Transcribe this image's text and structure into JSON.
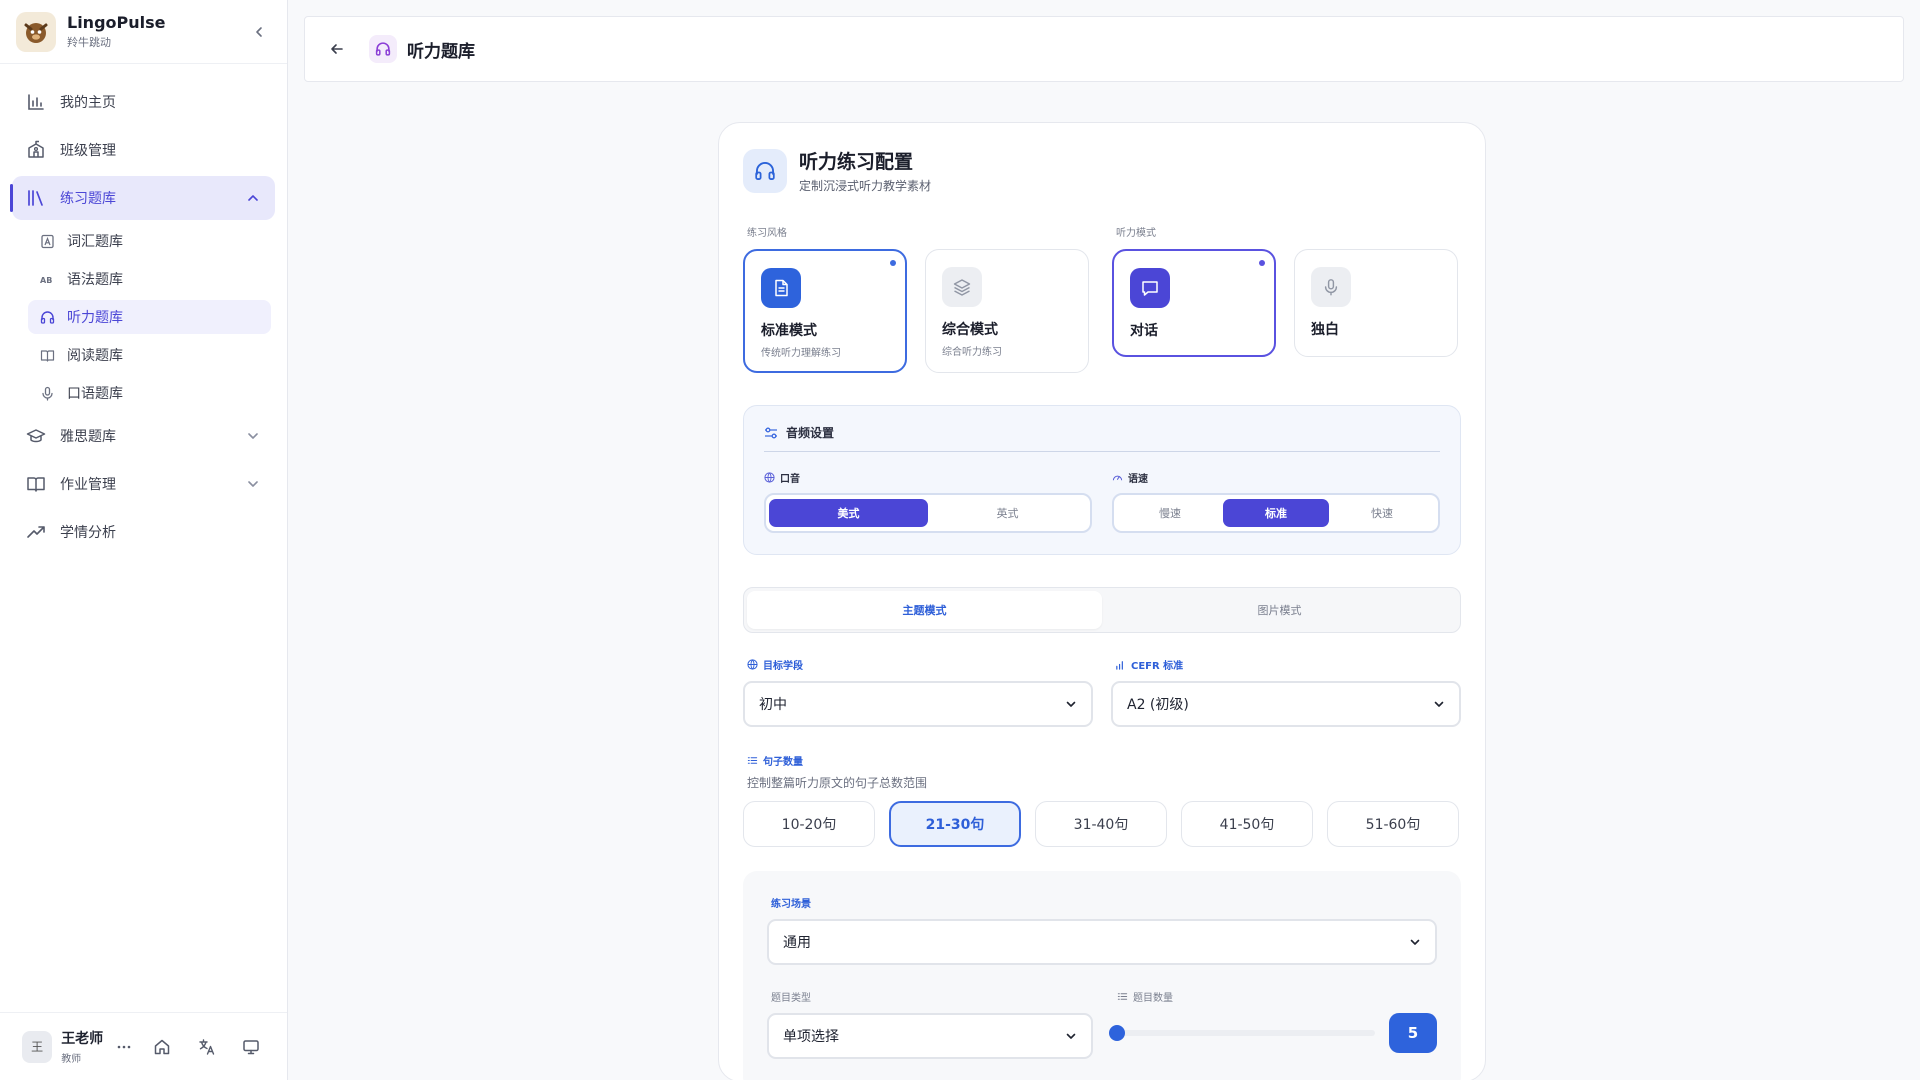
{
  "brand": {
    "name": "LingoPulse",
    "sub": "羚牛跳动"
  },
  "nav": {
    "items": [
      {
        "label": "我的主页"
      },
      {
        "label": "班级管理"
      },
      {
        "label": "练习题库"
      },
      {
        "label": "雅思题库"
      },
      {
        "label": "作业管理"
      },
      {
        "label": "学情分析"
      }
    ],
    "sub_items": [
      {
        "label": "词汇题库"
      },
      {
        "label": "语法题库"
      },
      {
        "label": "听力题库"
      },
      {
        "label": "阅读题库"
      },
      {
        "label": "口语题库"
      }
    ]
  },
  "user": {
    "avatar": "王",
    "name": "王老师",
    "role": "教师"
  },
  "header": {
    "title": "听力题库"
  },
  "config": {
    "title": "听力练习配置",
    "subtitle": "定制沉浸式听力教学素材",
    "style_label": "练习风格",
    "style_options": [
      {
        "title": "标准模式",
        "sub": "传统听力理解练习"
      },
      {
        "title": "综合模式",
        "sub": "综合听力练习"
      }
    ],
    "listen_label": "听力模式",
    "listen_options": [
      {
        "title": "对话"
      },
      {
        "title": "独白"
      }
    ],
    "audio": {
      "title": "音频设置",
      "accent_label": "口音",
      "accent_options": [
        "美式",
        "英式"
      ],
      "speed_label": "语速",
      "speed_options": [
        "慢速",
        "标准",
        "快速"
      ]
    },
    "tabs": [
      "主题模式",
      "图片模式"
    ],
    "stage": {
      "label": "目标学段",
      "value": "初中"
    },
    "cefr": {
      "label": "CEFR 标准",
      "value": "A2 (初级)"
    },
    "sentence": {
      "label": "句子数量",
      "desc": "控制整篇听力原文的句子总数范围",
      "options": [
        "10-20句",
        "21-30句",
        "31-40句",
        "41-50句",
        "51-60句"
      ]
    },
    "scene": {
      "label": "练习场景",
      "value": "通用",
      "type_label": "题目类型",
      "type_value": "单项选择",
      "count_label": "题目数量",
      "count_value": "5",
      "count_fraction": 0
    }
  },
  "colors": {
    "accent": "#4b46d6",
    "primary": "#2e63dc"
  }
}
